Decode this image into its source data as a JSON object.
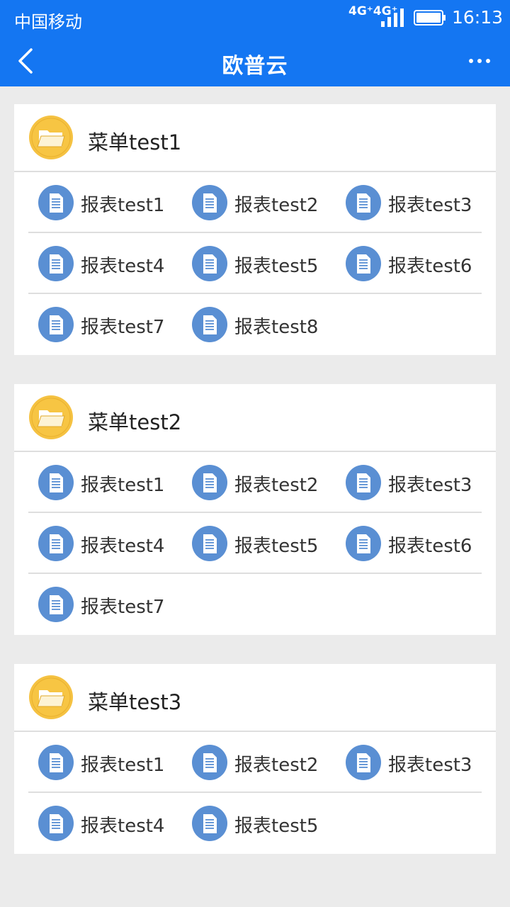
{
  "status_bar": {
    "carrier": "中国移动",
    "network": "4G⁺4G⁺",
    "time": "16:13"
  },
  "nav": {
    "title": "欧普云",
    "back_icon": "chevron-left-icon",
    "more_icon": "more-dots-icon"
  },
  "colors": {
    "primary": "#1476f2",
    "folder": "#f5c242",
    "doc": "#5a8fd3",
    "background": "#ebebeb"
  },
  "menus": [
    {
      "title": "菜单test1",
      "reports": [
        "报表test1",
        "报表test2",
        "报表test3",
        "报表test4",
        "报表test5",
        "报表test6",
        "报表test7",
        "报表test8"
      ]
    },
    {
      "title": "菜单test2",
      "reports": [
        "报表test1",
        "报表test2",
        "报表test3",
        "报表test4",
        "报表test5",
        "报表test6",
        "报表test7"
      ]
    },
    {
      "title": "菜单test3",
      "reports": [
        "报表test1",
        "报表test2",
        "报表test3",
        "报表test4",
        "报表test5"
      ]
    }
  ]
}
